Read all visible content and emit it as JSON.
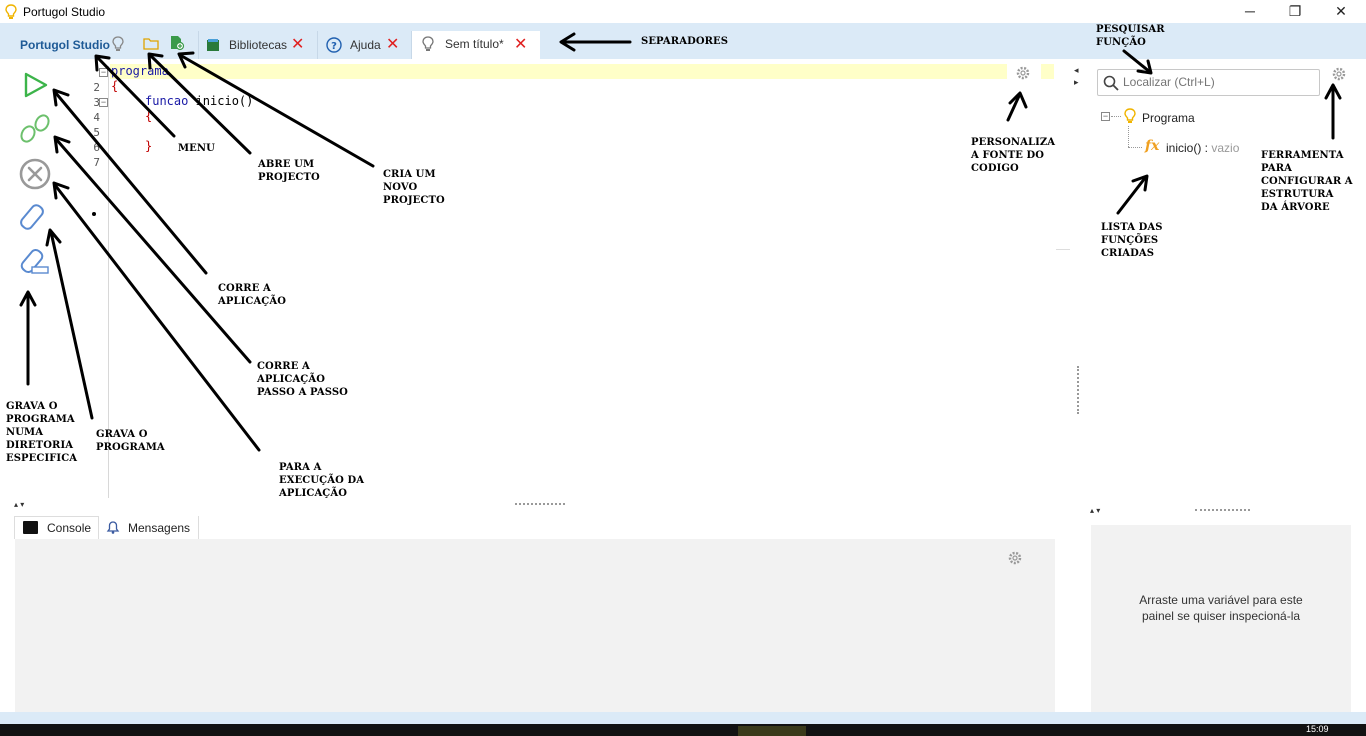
{
  "window": {
    "title": "Portugol Studio",
    "controls": {
      "minimize": "─",
      "maximize": "❐",
      "close": "✕"
    }
  },
  "tabs": {
    "home_label": "Portugol Studio",
    "libraries_label": "Bibliotecas",
    "help_label": "Ajuda",
    "file_label": "Sem título*"
  },
  "editor": {
    "line_numbers": [
      "1",
      "2",
      "3",
      "4",
      "5",
      "6",
      "7"
    ],
    "code": {
      "l1": "programa",
      "l2": "{",
      "l3_kw": "funcao",
      "l3_rest": " inicio()",
      "l4": "{",
      "l6": "}"
    }
  },
  "annotations": {
    "separadores": "SEPARADORES",
    "pesquisar": [
      "PESQUISAR",
      "FUNÇÃO"
    ],
    "menu": "MENU",
    "abre": [
      "ABRE UM",
      "PROJECTO"
    ],
    "cria": [
      "CRIA UM",
      "NOVO",
      "PROJECTO"
    ],
    "personaliza": [
      "PERSONALIZA",
      "A FONTE DO",
      "CODIGO"
    ],
    "ferramenta": [
      "FERRAMENTA",
      "PARA",
      "CONFIGURAR A",
      "ESTRUTURA",
      "DA ÁRVORE"
    ],
    "lista": [
      "LISTA DAS",
      "FUNÇÕES",
      "CRIADAS"
    ],
    "corre": [
      "CORRE A",
      "APLICAÇÃO"
    ],
    "passo": [
      "CORRE A",
      "APLICAÇÃO",
      "PASSO A PASSO"
    ],
    "grava_dir": [
      "GRAVA O",
      "PROGRAMA",
      "NUMA",
      "DIRETORIA",
      "ESPECIFICA"
    ],
    "grava": [
      "GRAVA O",
      "PROGRAMA"
    ],
    "para": [
      "PARA A",
      "EXECUÇÃO DA",
      "APLICAÇÃO"
    ]
  },
  "search": {
    "placeholder": "Localizar (Ctrl+L)"
  },
  "tree": {
    "root": "Programa",
    "function_name": "inicio()",
    "function_sep": " : ",
    "function_type": "vazio",
    "fx": "fx"
  },
  "bottom": {
    "console_label": "Console",
    "messages_label": "Mensagens"
  },
  "inspector": {
    "hint_line1": "Arraste uma variável para este",
    "hint_line2": "painel se quiser inspecioná-la"
  },
  "taskbar": {
    "clock": "15:09"
  },
  "colors": {
    "tab_bg": "#dbeaf7",
    "highlight": "#ffffc8",
    "accent": "#1e5a96",
    "close_red": "#e02020"
  }
}
